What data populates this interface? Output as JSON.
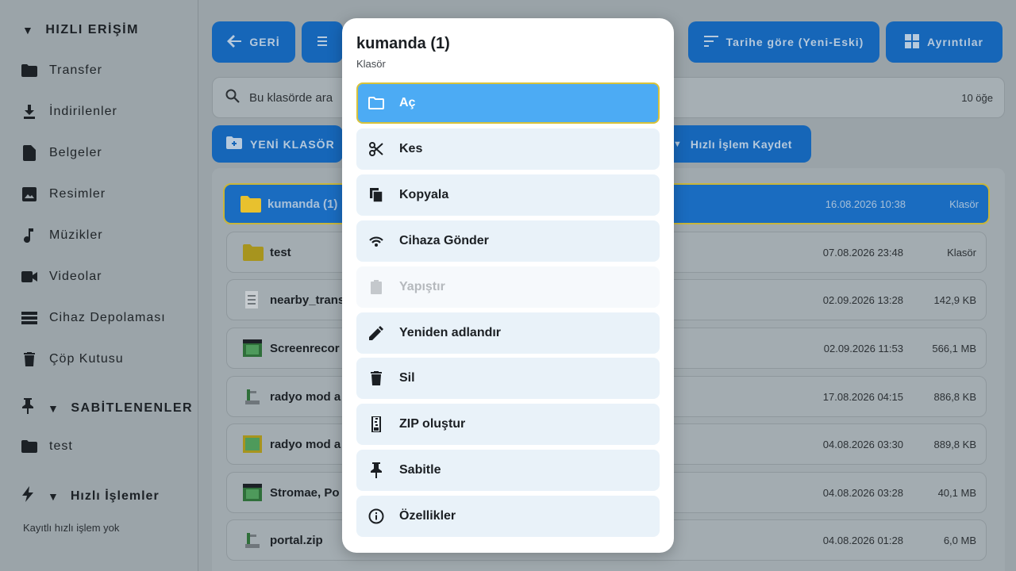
{
  "sidebar": {
    "quick_access_title": "HIZLI ERİŞİM",
    "items": [
      {
        "label": "Transfer",
        "icon": "folder-icon"
      },
      {
        "label": "İndirilenler",
        "icon": "download-icon"
      },
      {
        "label": "Belgeler",
        "icon": "document-icon"
      },
      {
        "label": "Resimler",
        "icon": "image-icon"
      },
      {
        "label": "Müzikler",
        "icon": "music-icon"
      },
      {
        "label": "Videolar",
        "icon": "video-icon"
      },
      {
        "label": "Cihaz Depolaması",
        "icon": "storage-icon"
      },
      {
        "label": "Çöp Kutusu",
        "icon": "trash-icon"
      }
    ],
    "pinned_title": "SABİTLENENLER",
    "pinned_items": [
      {
        "label": "test",
        "icon": "folder-icon"
      }
    ],
    "quick_actions_title": "Hızlı İşlemler",
    "quick_actions_empty": "Kayıtlı hızlı işlem yok"
  },
  "toolbar": {
    "back_label": "GERİ",
    "sort_label": "Tarihe göre (Yeni-Eski)",
    "details_label": "Ayrıntılar",
    "new_folder_label": "YENİ KLASÖR",
    "save_quick_action_label": "Hızlı İşlem Kaydet"
  },
  "search": {
    "placeholder": "Bu klasörde ara",
    "count": "10 öğe"
  },
  "files": [
    {
      "name": "kumanda (1)",
      "date": "16.08.2026 10:38",
      "size": "Klasör",
      "icon": "folder-icon",
      "selected": true
    },
    {
      "name": "test",
      "date": "07.08.2026 23:48",
      "size": "Klasör",
      "icon": "folder-icon"
    },
    {
      "name": "nearby_trans",
      "date": "02.09.2026 13:28",
      "size": "142,9 KB",
      "icon": "text-file-icon"
    },
    {
      "name": "Screenrecor",
      "date": "02.09.2026 11:53",
      "size": "566,1 MB",
      "icon": "video-file-icon"
    },
    {
      "name": "radyo mod a",
      "date": "17.08.2026 04:15",
      "size": "886,8 KB",
      "icon": "archive-file-icon"
    },
    {
      "name": "radyo mod a",
      "date": "04.08.2026 03:30",
      "size": "889,8 KB",
      "icon": "image-file-icon"
    },
    {
      "name": "Stromae, Po",
      "date": "04.08.2026 03:28",
      "size": "40,1 MB",
      "icon": "video-file-icon"
    },
    {
      "name": "portal.zip",
      "date": "04.08.2026 01:28",
      "size": "6,0 MB",
      "icon": "archive-file-icon"
    }
  ],
  "dialog": {
    "title": "kumanda (1)",
    "subtitle": "Klasör",
    "options": [
      {
        "label": "Aç",
        "icon": "folder-open-icon",
        "state": "active"
      },
      {
        "label": "Kes",
        "icon": "scissors-icon"
      },
      {
        "label": "Kopyala",
        "icon": "copy-icon"
      },
      {
        "label": "Cihaza Gönder",
        "icon": "wireless-icon"
      },
      {
        "label": "Yapıştır",
        "icon": "clipboard-icon",
        "state": "disabled"
      },
      {
        "label": "Yeniden adlandır",
        "icon": "pencil-icon"
      },
      {
        "label": "Sil",
        "icon": "trash-icon"
      },
      {
        "label": "ZIP oluştur",
        "icon": "zip-icon"
      },
      {
        "label": "Sabitle",
        "icon": "pin-icon"
      },
      {
        "label": "Özellikler",
        "icon": "info-icon"
      }
    ]
  },
  "colors": {
    "accent": "#1666b8",
    "active_option": "#4cabf4",
    "focus_border": "#d8c23a"
  }
}
